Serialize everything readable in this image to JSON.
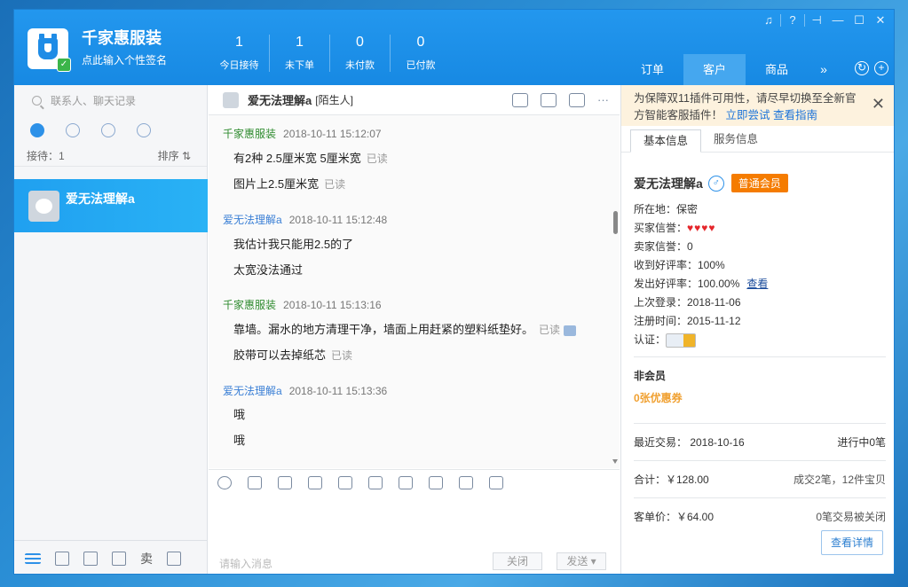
{
  "header": {
    "shop_name": "千家惠服装",
    "signature": "点此输入个性签名",
    "stats": [
      {
        "value": "1",
        "label": "今日接待"
      },
      {
        "value": "1",
        "label": "未下单"
      },
      {
        "value": "0",
        "label": "未付款"
      },
      {
        "value": "0",
        "label": "已付款"
      }
    ],
    "nav_tabs": [
      "订单",
      "客户",
      "商品"
    ],
    "active_tab": "客户"
  },
  "left": {
    "search_placeholder": "联系人、聊天记录",
    "reception_label": "接待：1",
    "sort_label": "排序 ⇅",
    "contacts": [
      {
        "name": "爱无法理解a"
      }
    ],
    "bottom_sell": "卖"
  },
  "chat": {
    "contact_name": "爱无法理解a",
    "contact_tag": "[陌生人]",
    "messages": [
      {
        "sender": "千家惠服装",
        "time": "2018-10-11 15:12:07",
        "lines": [
          {
            "text": "有2种 2.5厘米宽   5厘米宽",
            "status": "已读"
          },
          {
            "text": "图片上2.5厘米宽",
            "status": "已读"
          }
        ]
      },
      {
        "sender": "爱无法理解a",
        "time": "2018-10-11 15:12:48",
        "lines": [
          {
            "text": "我估计我只能用2.5的了",
            "status": ""
          },
          {
            "text": "太宽没法通过",
            "status": ""
          }
        ]
      },
      {
        "sender": "千家惠服装",
        "time": "2018-10-11 15:13:16",
        "lines": [
          {
            "text": "靠墙。漏水的地方清理干净，墙面上用赶紧的塑料纸垫好。",
            "status": "已读"
          },
          {
            "text": "胶带可以去掉纸芯",
            "status": "已读"
          }
        ]
      },
      {
        "sender": "爱无法理解a",
        "time": "2018-10-11 15:13:36",
        "lines": [
          {
            "text": "哦",
            "status": ""
          },
          {
            "text": "哦",
            "status": ""
          }
        ]
      }
    ],
    "input_placeholder": "请输入消息",
    "close_label": "关闭",
    "send_label": "发送 ▾"
  },
  "right": {
    "notice_text": "为保障双11插件可用性，请尽早切换至全新官方智能客服插件！",
    "notice_link1": "立即尝试",
    "notice_link2": "查看指南",
    "tabs": [
      "基本信息",
      "服务信息"
    ],
    "buyer_name": "爱无法理解a",
    "gender_symbol": "♂",
    "member_level": "普通会员",
    "location": "所在地：保密",
    "buyer_credit_label": "买家信誉：",
    "seller_credit": "卖家信誉：0",
    "good_received": "收到好评率：100%",
    "good_given": "发出好评率：100.00%",
    "view_link": "查看",
    "last_login": "上次登录：2018-11-06",
    "register_time": "注册时间：2015-11-12",
    "cert_label": "认证：",
    "non_member": "非会员",
    "coupons": "0张优惠券",
    "recent_trade": "最近交易： 2018-10-16",
    "in_progress": "进行中0笔",
    "total": "合计：￥128.00",
    "deal_count": "成交2笔，12件宝贝",
    "unit_price": "客单价：￥64.00",
    "closed_count": "0笔交易被关闭",
    "detail_button": "查看详情"
  }
}
